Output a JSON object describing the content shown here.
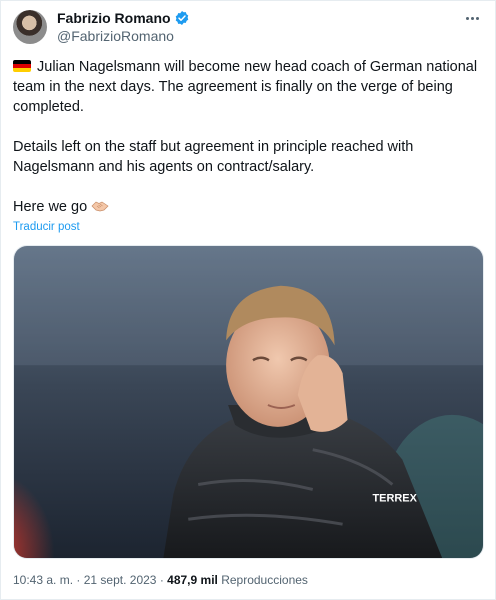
{
  "author": {
    "display_name": "Fabrizio Romano",
    "handle": "@FabrizioRomano",
    "verified_badge": "verified-badge-icon"
  },
  "tweet": {
    "paragraph_1": "Julian Nagelsmann will become new head coach of German national team in the next days. The agreement is finally on the verge of being completed.",
    "paragraph_2": "Details left on the staff but agreement in principle reached with Nagelsmann and his agents on contract/salary.",
    "paragraph_3": "Here we go",
    "translate_label": "Traducir post"
  },
  "media": {
    "jacket_brand": "TERREX"
  },
  "meta": {
    "time": "10:43 a. m.",
    "date": "21 sept. 2023",
    "views_count": "487,9 mil",
    "views_label": "Reproducciones",
    "separator": "·"
  },
  "colors": {
    "accent": "#1d9bf0",
    "muted": "#536471",
    "text": "#0f1419"
  }
}
